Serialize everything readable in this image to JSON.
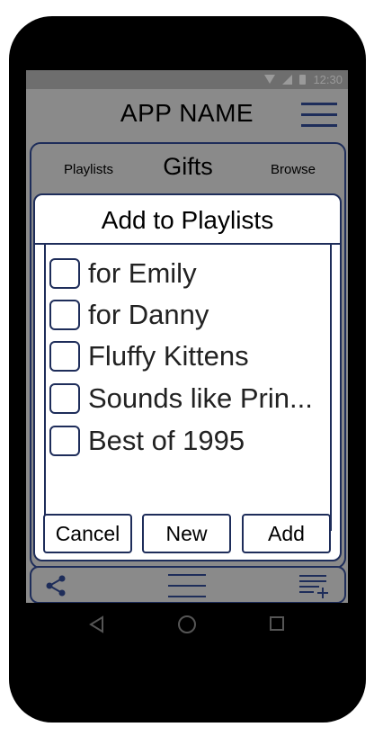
{
  "status_bar": {
    "time": "12:30"
  },
  "app_bar": {
    "title": "APP NAME"
  },
  "tabs": {
    "left": "Playlists",
    "center": "Gifts",
    "right": "Browse"
  },
  "dialog": {
    "title": "Add to Playlists",
    "items": [
      {
        "label": "for Emily",
        "checked": false
      },
      {
        "label": "for Danny",
        "checked": false
      },
      {
        "label": "Fluffy Kittens",
        "checked": false
      },
      {
        "label": "Sounds like Prin...",
        "checked": false
      },
      {
        "label": "Best of 1995",
        "checked": false
      }
    ],
    "buttons": {
      "cancel": "Cancel",
      "new": "New",
      "add": "Add"
    }
  },
  "colors": {
    "accent": "#1e2d5a",
    "screen_bg": "#8a8a8a",
    "dialog_bg": "#ffffff"
  },
  "icons": [
    "wifi-icon",
    "signal-icon",
    "battery-icon",
    "hamburger-menu-icon",
    "share-icon",
    "menu-icon",
    "playlist-add-icon",
    "back-icon",
    "home-icon",
    "recent-apps-icon"
  ]
}
